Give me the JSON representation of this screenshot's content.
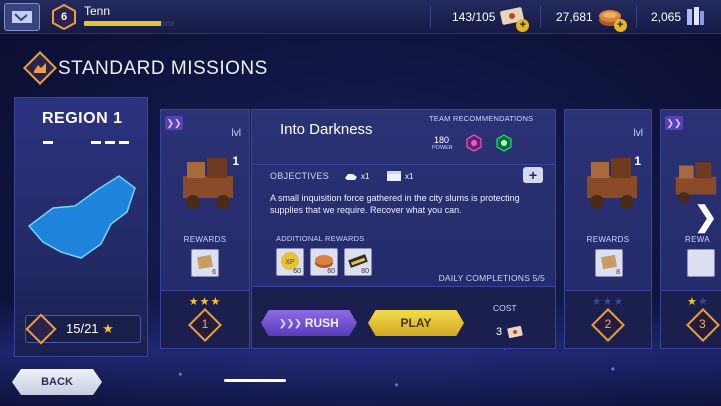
{
  "player": {
    "level": "6",
    "name": "Tenn",
    "xp_fraction": 0.85
  },
  "resources": [
    {
      "id": "energy",
      "value": "143/105",
      "icon": "ticket-icon"
    },
    {
      "id": "gold",
      "value": "27,681",
      "icon": "coin-stack-icon"
    },
    {
      "id": "gems",
      "value": "2,065",
      "icon": "crystal-icon"
    }
  ],
  "page": {
    "title": "STANDARD MISSIONS"
  },
  "region": {
    "title": "REGION 1",
    "progress": "15/21"
  },
  "main_mission": {
    "title": "Into Darkness",
    "team_label": "TEAM RECOMMENDATIONS",
    "power_value": "180",
    "power_label": "POWER",
    "objectives_label": "OBJECTIVES",
    "objectives": [
      {
        "icon": "creature-icon",
        "count": "x1"
      },
      {
        "icon": "chest-icon",
        "count": "x1"
      }
    ],
    "description": "A small inquisition force gathered in the city slums is protecting supplies that we require. Recover what you can.",
    "additional_label": "ADDITIONAL REWARDS",
    "additional_rewards": [
      {
        "icon": "xp-icon",
        "label": "XP",
        "count": "60"
      },
      {
        "icon": "coin-icon",
        "count": "60"
      },
      {
        "icon": "scroll-icon",
        "count": "80"
      }
    ],
    "daily": "DAILY COMPLETIONS 5/5",
    "rush_label": "RUSH",
    "play_label": "PLAY",
    "cost_label": "COST",
    "cost_value": "3"
  },
  "left_card": {
    "lvl_label": "lvl",
    "lvl_value": "1",
    "rewards_label": "REWARDS",
    "reward_count": "6",
    "difficulty": "1",
    "stars_earned": 3
  },
  "right_card": {
    "lvl_label": "lvl",
    "lvl_value": "1",
    "rewards_label": "REWARDS",
    "reward_count": "8",
    "difficulty": "2",
    "stars_earned": 0
  },
  "far_right_card": {
    "rewards_label": "REWA",
    "difficulty": "3"
  },
  "back_label": "BACK",
  "colors": {
    "accent_gold": "#f2c431",
    "rush_purple": "#7a55d6",
    "play_yellow": "#e6c23a",
    "diamond_orange": "#e8a040"
  }
}
